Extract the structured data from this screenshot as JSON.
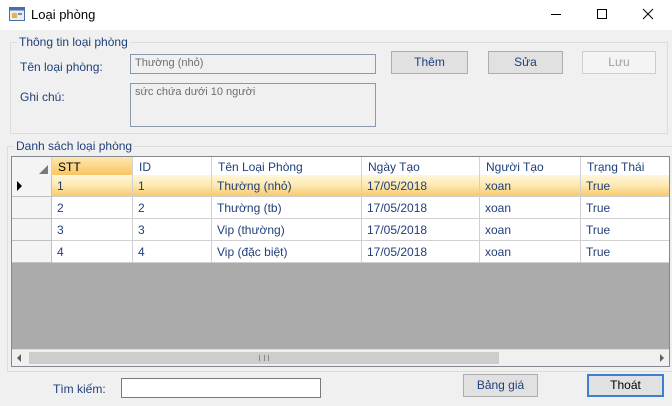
{
  "window": {
    "title": "Loại phòng"
  },
  "info": {
    "legend": "Thông tin loại phòng",
    "name_label": "Tên loại phòng:",
    "name_value": "Thường (nhỏ)",
    "note_label": "Ghi chú:",
    "note_value": "sức chứa dưới 10 người",
    "add_label": "Thêm",
    "edit_label": "Sửa",
    "save_label": "Lưu"
  },
  "list": {
    "legend": "Danh sách loại phòng",
    "columns": [
      "STT",
      "ID",
      "Tên Loại Phòng",
      "Ngày Tạo",
      "Người Tạo",
      "Trạng Thái"
    ],
    "rows": [
      [
        "1",
        "1",
        "Thường (nhỏ)",
        "17/05/2018",
        "xoan",
        "True"
      ],
      [
        "2",
        "2",
        "Thường (tb)",
        "17/05/2018",
        "xoan",
        "True"
      ],
      [
        "3",
        "3",
        "Vip (thường)",
        "17/05/2018",
        "xoan",
        "True"
      ],
      [
        "4",
        "4",
        "Vip (đặc biệt)",
        "17/05/2018",
        "xoan",
        "True"
      ]
    ],
    "selected_row": 0
  },
  "footer": {
    "search_label": "Tìm kiếm:",
    "search_value": "",
    "price_label": "Bảng giá",
    "exit_label": "Thoát"
  },
  "colors": {
    "label_text": "#1f3f7a",
    "selected_row": "#f8c766",
    "grid_background": "#ababab",
    "accent_border": "#3c7fd4"
  },
  "icons": [
    "app-icon",
    "minimize-icon",
    "maximize-icon",
    "close-icon",
    "row-selector-arrow-icon",
    "scroll-left-icon",
    "scroll-right-icon"
  ]
}
